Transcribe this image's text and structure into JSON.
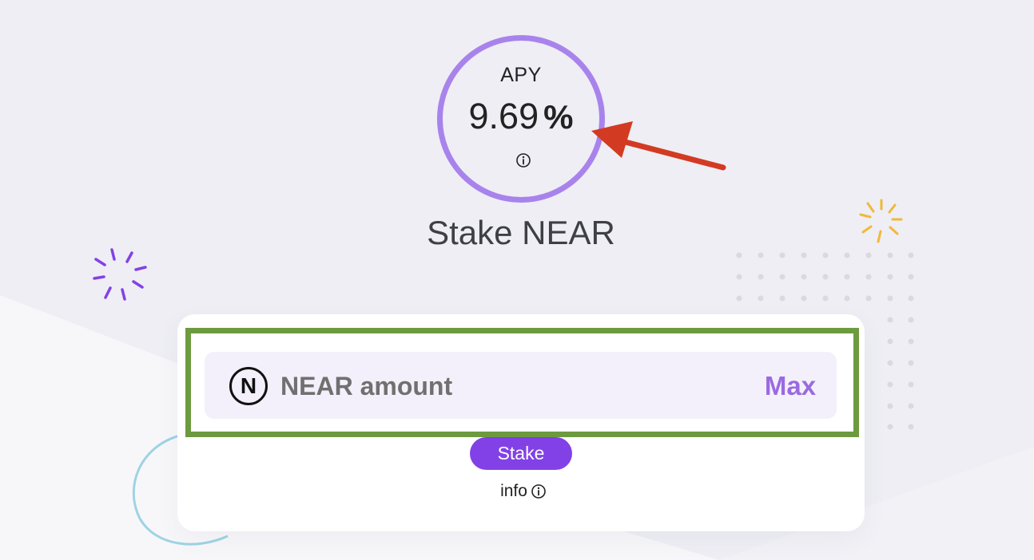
{
  "apy": {
    "label": "APY",
    "value": "9.69",
    "unit": "%"
  },
  "page": {
    "title": "Stake NEAR"
  },
  "stake_form": {
    "token_symbol": "N",
    "amount_placeholder": "NEAR amount",
    "max_label": "Max",
    "stake_label": "Stake",
    "info_label": "info"
  },
  "icons": {
    "near": "near-logo-icon",
    "info": "info-circle-icon",
    "annotation_arrow": "red-arrow-icon"
  },
  "colors": {
    "ring": "#a883ec",
    "accent": "#8241e6",
    "max": "#9a6ae0",
    "highlight": "#6e9a3f",
    "arrow": "#d33a22",
    "field_bg": "#f3f0fb"
  }
}
